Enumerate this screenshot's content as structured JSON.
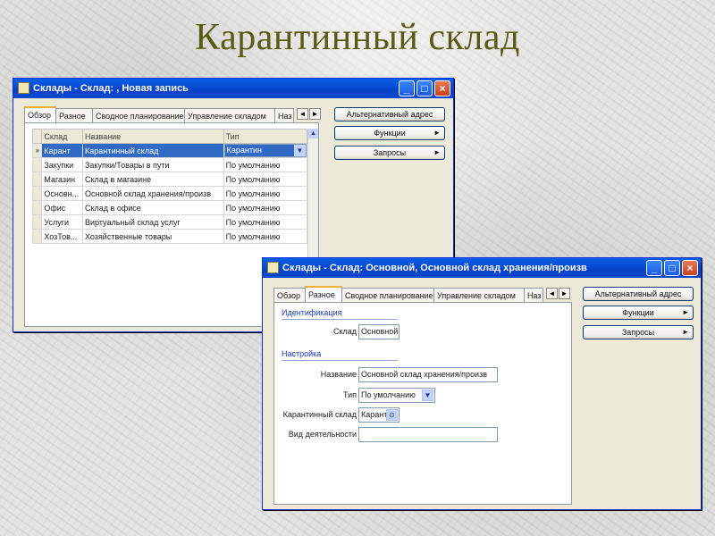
{
  "slide_title": "Карантинный склад",
  "window1": {
    "title": "Склады - Склад: , Новая запись",
    "tabs": [
      "Обзор",
      "Разное",
      "Сводное планирование",
      "Управление складом",
      "Наз"
    ],
    "columns": [
      "Склад",
      "Название",
      "Тип"
    ],
    "rows": [
      {
        "marker": "»",
        "code": "Карант",
        "name": "Карантинный склад",
        "type": "Карантин"
      },
      {
        "marker": "",
        "code": "Закупки",
        "name": "Закупки/Товары в пути",
        "type": "По умолчанию"
      },
      {
        "marker": "",
        "code": "Магазин",
        "name": "Склад в магазине",
        "type": "По умолчанию"
      },
      {
        "marker": "",
        "code": "Основн...",
        "name": "Основной склад хранения/произв",
        "type": "По умолчанию"
      },
      {
        "marker": "",
        "code": "Офис",
        "name": "Склад в офисе",
        "type": "По умолчанию"
      },
      {
        "marker": "",
        "code": "Услуги",
        "name": "Виртуальный склад услуг",
        "type": "По умолчанию"
      },
      {
        "marker": "",
        "code": "ХозТов...",
        "name": "Хозяйственные товары",
        "type": "По умолчанию"
      }
    ],
    "buttons": {
      "alt_address": "Альтернативный адрес",
      "functions": "Функции",
      "queries": "Запросы"
    }
  },
  "window2": {
    "title": "Склады - Склад: Основной, Основной склад хранения/произв",
    "tabs": [
      "Обзор",
      "Разное",
      "Сводное планирование",
      "Управление складом",
      "Наз"
    ],
    "section_identification": "Идентификация",
    "section_settings": "Настройка",
    "fields": {
      "warehouse_label": "Склад",
      "warehouse_value": "Основной",
      "name_label": "Название",
      "name_value": "Основной склад хранения/произв",
      "type_label": "Тип",
      "type_value": "По умолчанию",
      "quarantine_label": "Карантинный склад",
      "quarantine_value": "Карант",
      "activity_label": "Вид деятельности",
      "activity_value": ""
    },
    "buttons": {
      "alt_address": "Альтернативный адрес",
      "functions": "Функции",
      "queries": "Запросы"
    }
  }
}
